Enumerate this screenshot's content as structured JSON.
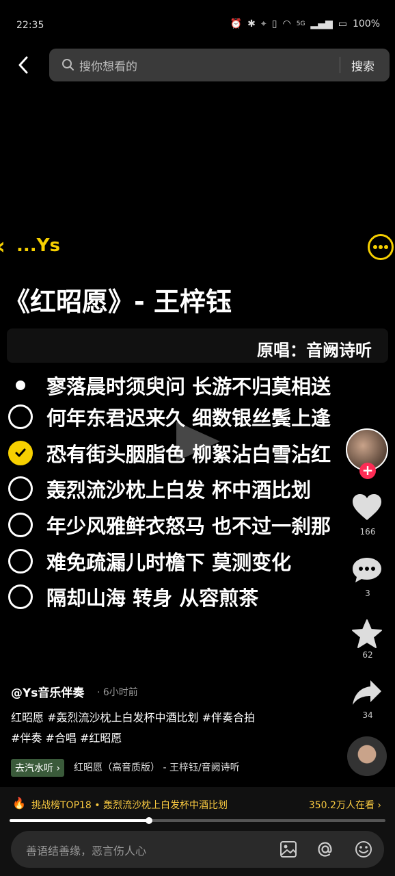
{
  "status_bar": {
    "time": "22:35",
    "battery": "100%",
    "network": "5G"
  },
  "search": {
    "placeholder": "搜你想看的",
    "button_label": "搜索"
  },
  "author": {
    "name": "...Ys"
  },
  "song": {
    "title": "《红昭愿》- 王梓钰",
    "original_singer": "原唱：音阙诗听"
  },
  "lyrics": [
    {
      "text": "寥落晨时须臾问 长游不归莫相送",
      "state": "current"
    },
    {
      "text": "何年东君迟来久 细数银丝鬓上逢",
      "state": "unchecked"
    },
    {
      "text": "恐有街头胭脂色 柳絮沾白雪沾红",
      "state": "checked"
    },
    {
      "text": "轰烈流沙枕上白发 杯中酒比划",
      "state": "unchecked"
    },
    {
      "text": "年少风雅鲜衣怒马 也不过一刹那",
      "state": "unchecked"
    },
    {
      "text": "难免疏漏儿时檐下 莫测变化",
      "state": "unchecked"
    },
    {
      "text": "隔却山海 转身 从容煎茶",
      "state": "unchecked"
    }
  ],
  "rail": {
    "likes": "166",
    "comments": "3",
    "favorites": "62",
    "shares": "34"
  },
  "post": {
    "handle": "@Ys音乐伴奏",
    "time_ago": "· 6小时前",
    "desc_line1": "红昭愿 #轰烈流沙枕上白发杯中酒比划 #伴奏合拍",
    "desc_line2": "#伴奏 #合唱 #红昭愿",
    "music_tag": "去汽水听 ›",
    "music_title": "红昭愿（高音质版） - 王梓钰/音阙诗听"
  },
  "bottom": {
    "challenge": "挑战榜TOP18 • 轰烈流沙枕上白发杯中酒比划",
    "viewers": "350.2万人在看 ›",
    "progress": 0.37,
    "comment_placeholder": "善语结善缘，恶言伤人心"
  },
  "colors": {
    "accent": "#f7d000",
    "follow": "#fe2c55",
    "bg": "#000000"
  }
}
